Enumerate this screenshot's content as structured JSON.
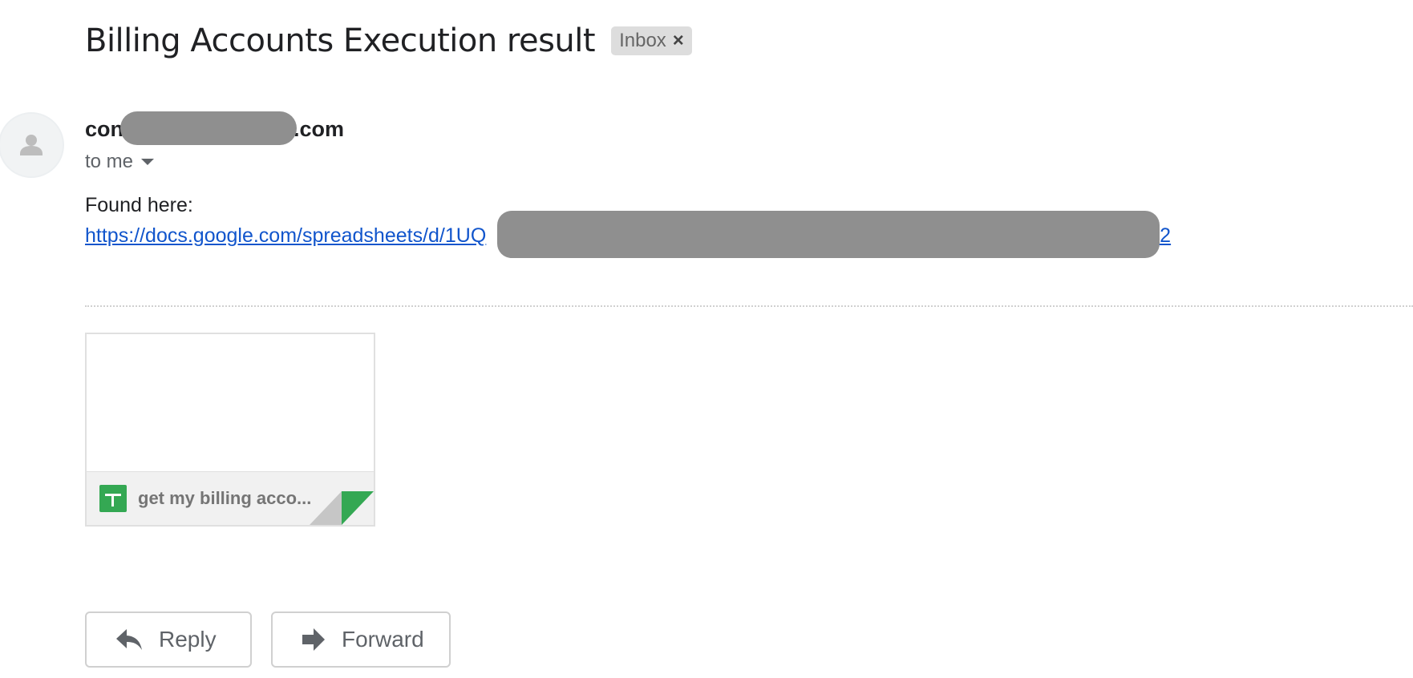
{
  "email": {
    "subject": "Billing Accounts Execution result",
    "label": "Inbox",
    "label_remove": "×",
    "sender_prefix": "con",
    "sender_suffix": ".com",
    "recipient": "to me",
    "body_line": "Found here:",
    "link_prefix": "https://docs.google.com/spreadsheets/d/1UQ",
    "link_suffix": "72"
  },
  "attachment": {
    "name": "get my billing acco...",
    "icon": "google-sheets-icon",
    "icon_color": "#34a853"
  },
  "actions": {
    "reply_label": "Reply",
    "forward_label": "Forward"
  },
  "colors": {
    "link": "#1155cc",
    "redaction": "#8f8f8f",
    "label_chip": "#dddddd"
  }
}
